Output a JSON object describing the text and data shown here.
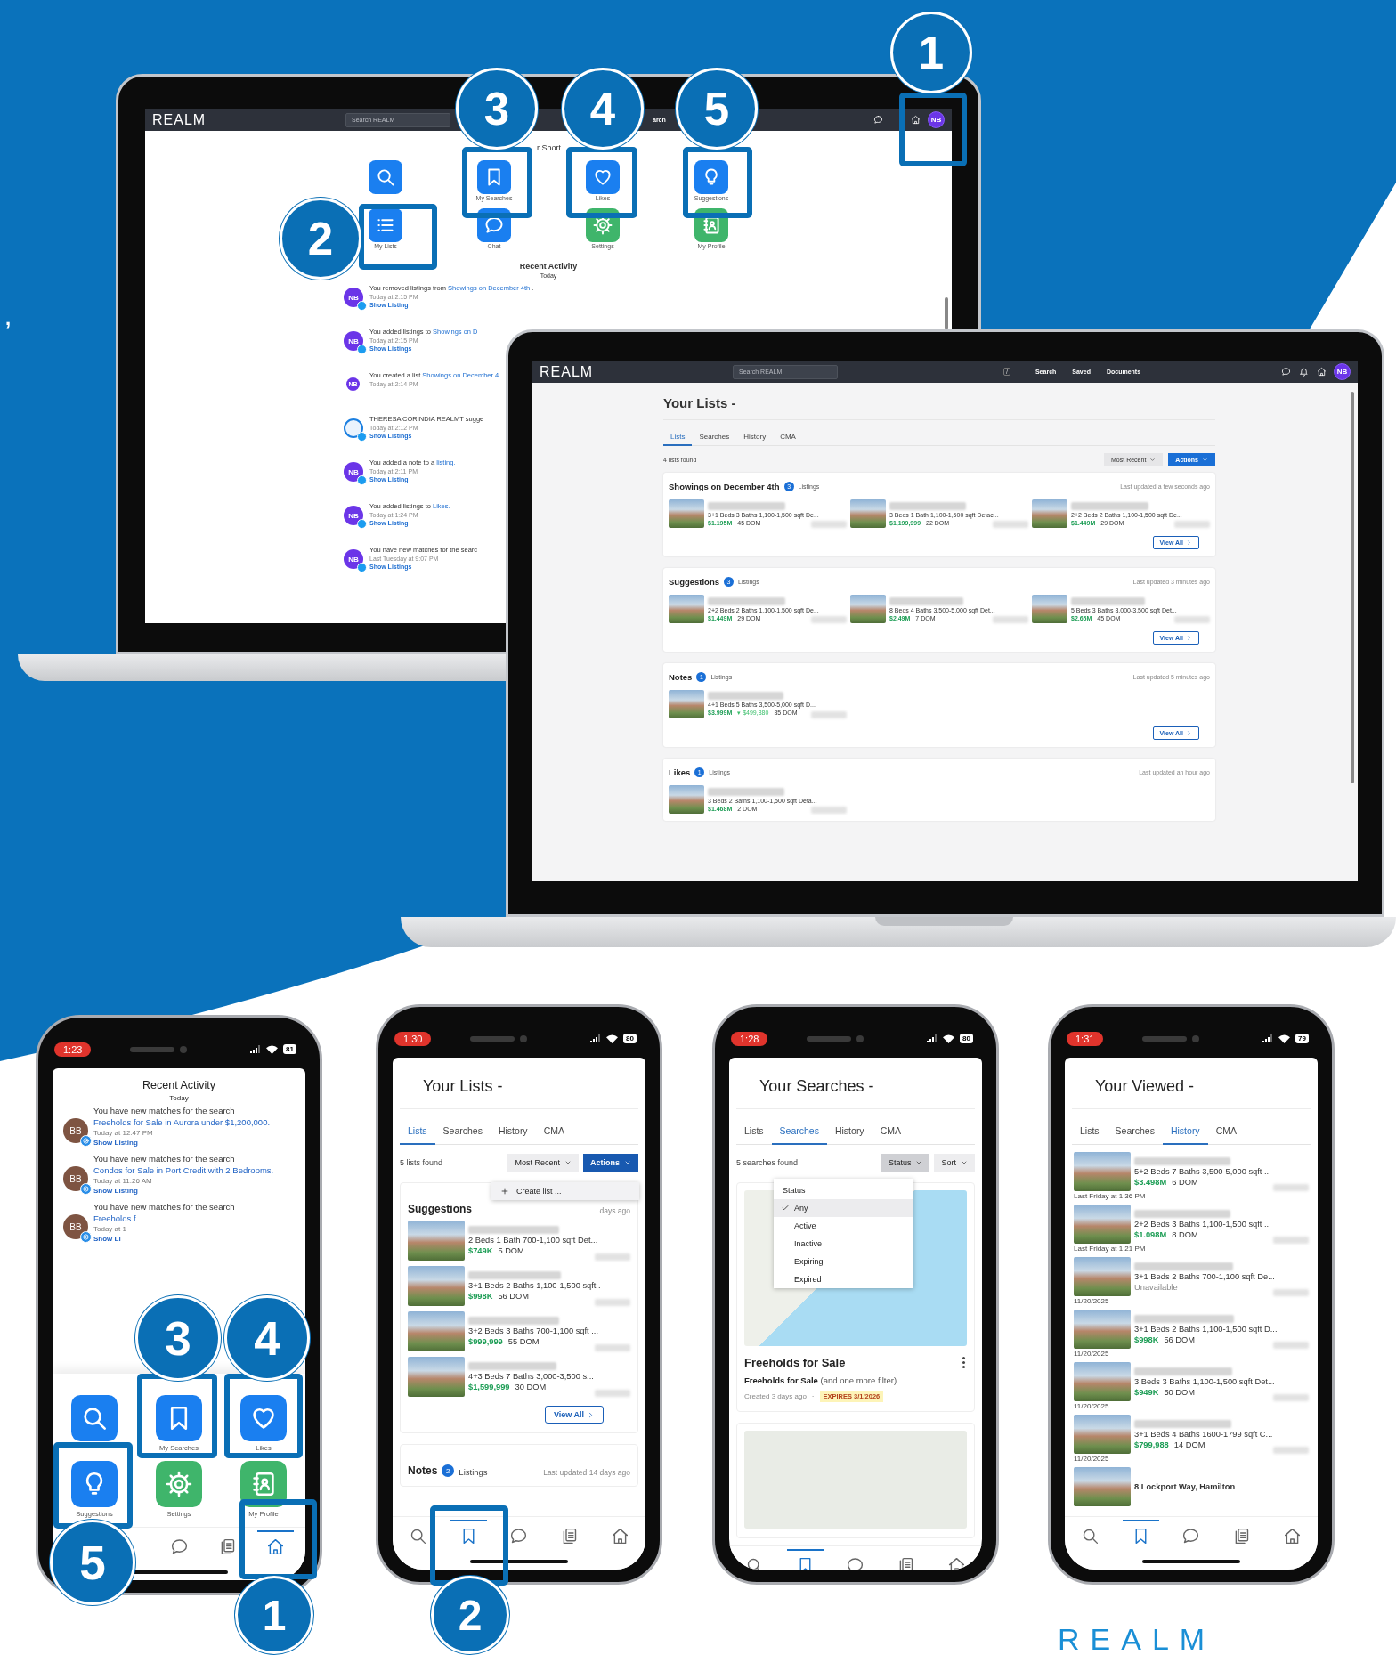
{
  "backdrop": {
    "edge_text": ",",
    "logo": "REALM"
  },
  "laptops": [
    {
      "kind": "home",
      "header": {
        "logo": "REALM",
        "search_placeholder": "Search REALM",
        "nav": [
          "arch"
        ],
        "icons": [
          {
            "kind": "chat"
          },
          {
            "kind": "home"
          }
        ],
        "avatar": "NB"
      },
      "shortcuts_heading": "r Short",
      "shortcuts": [
        {
          "kind": "search",
          "color": "#1a7ff0"
        },
        {
          "kind": "bookmark",
          "label": "My Searches",
          "color": "#1a7ff0"
        },
        {
          "kind": "heart",
          "label": "Likes",
          "color": "#1a7ff0"
        },
        {
          "kind": "bulb",
          "label": "Suggestions",
          "color": "#1a7ff0"
        },
        {
          "kind": "list",
          "label": "My Lists",
          "color": "#1a7ff0"
        },
        {
          "kind": "chat",
          "label": "Chat",
          "color": "#1a7ff0"
        },
        {
          "kind": "gear",
          "label": "Settings",
          "color": "#3fb56b"
        },
        {
          "kind": "profile",
          "label": "My Profile",
          "color": "#3fb56b"
        }
      ],
      "activity": {
        "title": "Recent Activity",
        "day": "Today",
        "items": [
          {
            "avatar": "NB",
            "kind": "user",
            "text": "You removed listings from ",
            "link": "Showings on December 4th",
            "after": " .",
            "time": "Today at 2:15 PM",
            "action": "Show Listing"
          },
          {
            "avatar": "NB",
            "kind": "user",
            "text": "You added listings to ",
            "link": "Showings on D",
            "time": "Today at 2:15 PM",
            "action": "Show Listings"
          },
          {
            "avatar": "NB",
            "kind": "small",
            "text": "You created a list ",
            "link": "Showings on December 4",
            "time": "Today at 2:14 PM"
          },
          {
            "kind": "agent",
            "text": "THERESA CORINDIA REALMT sugge",
            "time": "Today at 2:12 PM",
            "action": "Show Listings"
          },
          {
            "avatar": "NB",
            "kind": "user",
            "text": "You added a note to a ",
            "link": "listing.",
            "time": "Today at 2:11 PM",
            "action": "Show Listing"
          },
          {
            "avatar": "NB",
            "kind": "user",
            "text": "You added listings to ",
            "link": "Likes.",
            "time": "Today at 1:24 PM",
            "action": "Show Listing"
          },
          {
            "avatar": "NB",
            "kind": "user",
            "text": "You have new matches for the searc",
            "time": "Last Tuesday at 9:07 PM",
            "action": "Show Listings"
          }
        ]
      }
    },
    {
      "kind": "lists",
      "header": {
        "logo": "REALM",
        "search_placeholder": "Search REALM",
        "key_hint": "/",
        "nav": [
          "Search",
          "Saved",
          "Documents"
        ],
        "icons": [
          {
            "kind": "chat"
          },
          {
            "kind": "bell"
          },
          {
            "kind": "home"
          }
        ],
        "avatar": "NB"
      },
      "title": "Your Lists -",
      "tabs": [
        {
          "label": "Lists",
          "selected": true
        },
        {
          "label": "Searches",
          "selected": false
        },
        {
          "label": "History",
          "selected": false
        },
        {
          "label": "CMA",
          "selected": false
        }
      ],
      "count": "4 lists found",
      "sort": "Most Recent",
      "actions": "Actions",
      "cards": [
        {
          "title": "Showings on December 4th",
          "count": "3",
          "count_label": "Listings",
          "updated": "Last updated a few seconds ago",
          "view_all": "View All",
          "listings": [
            {
              "details": "3+1 Beds 3 Baths 1,100-1,500 sqft De...",
              "price": "$1.195M",
              "dom": "45 DOM"
            },
            {
              "details": "3 Beds 1 Bath 1,100-1,500 sqft Detac...",
              "price": "$1,199,999",
              "dom": "22 DOM"
            },
            {
              "details": "2+2 Beds 2 Baths 1,100-1,500 sqft De...",
              "price": "$1.449M",
              "dom": "29 DOM"
            }
          ]
        },
        {
          "title": "Suggestions",
          "count": "3",
          "count_label": "Listings",
          "updated": "Last updated 3 minutes ago",
          "view_all": "View All",
          "listings": [
            {
              "details": "2+2 Beds 2 Baths 1,100-1,500 sqft De...",
              "price": "$1.449M",
              "dom": "29 DOM"
            },
            {
              "details": "8 Beds 4 Baths 3,500-5,000 sqft Det...",
              "price": "$2.49M",
              "dom": "7 DOM"
            },
            {
              "details": "5 Beds 3 Baths 3,000-3,500 sqft Det...",
              "price": "$2.65M",
              "dom": "45 DOM"
            }
          ]
        },
        {
          "title": "Notes",
          "count": "1",
          "count_label": "Listings",
          "updated": "Last updated 5 minutes ago",
          "view_all": "View All",
          "listings": [
            {
              "details": "4+1 Beds 5 Baths 3,500-5,000 sqft D...",
              "price": "$3.999M",
              "drop": "▾ $499,880",
              "dom": "35 DOM"
            }
          ]
        },
        {
          "title": "Likes",
          "count": "1",
          "count_label": "Listings",
          "updated": "Last updated an hour ago",
          "listings": [
            {
              "details": "3 Beds 2 Baths 1,100-1,500 sqft Deta...",
              "price": "$1.468M",
              "dom": "2 DOM"
            }
          ]
        }
      ]
    }
  ],
  "phones": [
    {
      "kind": "activity",
      "time": "1:23",
      "battery": "81",
      "title": "Recent Activity",
      "day": "Today",
      "items": [
        {
          "avatar": "BB",
          "intro": "You have new matches for the search",
          "link": "Freeholds for Sale in Aurora under $1,200,000.",
          "time": "Today at 12:47 PM",
          "action": "Show Listing"
        },
        {
          "avatar": "BB",
          "intro": "You have new matches for the search",
          "link": "Condos for Sale in Port Credit with 2 Bedrooms.",
          "time": "Today at 11:26 AM",
          "action": "Show Listing"
        },
        {
          "avatar": "BB",
          "intro": "You have new matches for the search",
          "link": "Freeholds f",
          "time": "Today at 1",
          "action": "Show Li"
        }
      ],
      "shortcuts": [
        {
          "kind": "search",
          "color": "#1a7ff0"
        },
        {
          "kind": "bookmark",
          "label": "My Searches",
          "color": "#1a7ff0"
        },
        {
          "kind": "heart",
          "label": "Likes",
          "color": "#1a7ff0"
        },
        {
          "kind": "bulb",
          "label": "Suggestions",
          "color": "#1a7ff0"
        },
        {
          "kind": "gear",
          "label": "Settings",
          "color": "#3fb56b"
        },
        {
          "kind": "profile",
          "label": "My Profile",
          "color": "#3fb56b"
        }
      ],
      "nav": [
        {
          "kind": "chat",
          "selected": false
        },
        {
          "kind": "documents",
          "selected": false
        },
        {
          "kind": "home",
          "selected": true
        }
      ]
    },
    {
      "kind": "lists",
      "time": "1:30",
      "battery": "80",
      "title": "Your Lists -",
      "tabs": [
        {
          "label": "Lists",
          "selected": true
        },
        {
          "label": "Searches",
          "selected": false
        },
        {
          "label": "History",
          "selected": false
        },
        {
          "label": "CMA",
          "selected": false
        }
      ],
      "count": "5 lists found",
      "sort": "Most Recent",
      "actions": "Actions",
      "menu_item": "Create list ...",
      "cards": [
        {
          "title": "Suggestions",
          "updated": "days ago",
          "view_all": "View All",
          "listings": [
            {
              "details": "2 Beds 1 Bath 700-1,100 sqft Det...",
              "price": "$749K",
              "dom": "5 DOM"
            },
            {
              "details": "3+1 Beds 2 Baths 1,100-1,500 sqft .",
              "price": "$998K",
              "dom": "56 DOM"
            },
            {
              "details": "3+2 Beds 3 Baths 700-1,100 sqft ...",
              "price": "$999,999",
              "dom": "55 DOM"
            },
            {
              "details": "4+3 Beds 7 Baths 3,000-3,500 s...",
              "price": "$1,599,999",
              "dom": "30 DOM"
            }
          ]
        },
        {
          "title": "Notes",
          "count": "2",
          "count_label": "Listings",
          "updated": "Last updated 14 days ago"
        }
      ],
      "nav": [
        {
          "kind": "search",
          "selected": false
        },
        {
          "kind": "bookmark",
          "selected": true
        },
        {
          "kind": "chat",
          "selected": false
        },
        {
          "kind": "documents",
          "selected": false
        },
        {
          "kind": "home",
          "selected": false
        }
      ]
    },
    {
      "kind": "searches",
      "time": "1:28",
      "battery": "80",
      "title": "Your Searches -",
      "tabs": [
        {
          "label": "Lists",
          "selected": false
        },
        {
          "label": "Searches",
          "selected": true
        },
        {
          "label": "History",
          "selected": false
        },
        {
          "label": "CMA",
          "selected": false
        }
      ],
      "count": "5 searches found",
      "filters": [
        {
          "label": "Status",
          "selected": true
        },
        {
          "label": "Sort",
          "selected": false
        }
      ],
      "menu": {
        "title": "Status",
        "options": [
          {
            "label": "Any",
            "selected": true
          },
          {
            "label": "Active",
            "selected": false
          },
          {
            "label": "Inactive",
            "selected": false
          },
          {
            "label": "Expiring",
            "selected": false
          },
          {
            "label": "Expired",
            "selected": false
          }
        ]
      },
      "searches": [
        {
          "kind": "detailed",
          "title": "Freeholds for Sale",
          "summary": "**Freeholds for Sale** (and one more filter)",
          "created": "Created 3 days ago",
          "separator": "·",
          "expires": "EXPIRES 3/1/2026"
        },
        {
          "kind": "map_only"
        }
      ],
      "nav": [
        {
          "kind": "search",
          "selected": false
        },
        {
          "kind": "bookmark",
          "selected": true
        },
        {
          "kind": "chat",
          "selected": false
        },
        {
          "kind": "documents",
          "selected": false
        },
        {
          "kind": "home",
          "selected": false
        }
      ]
    },
    {
      "kind": "viewed",
      "time": "1:31",
      "battery": "79",
      "title": "Your Viewed -",
      "tabs": [
        {
          "label": "Lists",
          "selected": false
        },
        {
          "label": "Searches",
          "selected": false
        },
        {
          "label": "History",
          "selected": true
        },
        {
          "label": "CMA",
          "selected": false
        }
      ],
      "listings": [
        {
          "details": "5+2 Beds 7 Baths 3,500-5,000 sqft ...",
          "price": "$3.498M",
          "dom": "6 DOM",
          "viewed": "Last Friday at 1:36 PM"
        },
        {
          "details": "2+2 Beds 3 Baths 1,100-1,500 sqft ...",
          "price": "$1.098M",
          "dom": "8 DOM",
          "viewed": "Last Friday at 1:21 PM"
        },
        {
          "details": "3+1 Beds 2 Baths 700-1,100 sqft De...",
          "status": "Unavailable",
          "viewed": "11/20/2025"
        },
        {
          "details": "3+1 Beds 2 Baths 1,100-1,500 sqft D...",
          "price": "$998K",
          "dom": "56 DOM",
          "viewed": "11/20/2025"
        },
        {
          "details": "3 Beds 3 Baths 1,100-1,500 sqft Det...",
          "price": "$949K",
          "dom": "50 DOM",
          "viewed": "11/20/2025"
        },
        {
          "details": "3+1 Beds 4 Baths 1600-1799 sqft C...",
          "price": "$799,988",
          "dom": "14 DOM",
          "viewed": "11/20/2025"
        },
        {
          "address": "8 Lockport Way, Hamilton"
        }
      ],
      "nav": [
        {
          "kind": "search",
          "selected": false
        },
        {
          "kind": "bookmark",
          "selected": true
        },
        {
          "kind": "chat",
          "selected": false
        },
        {
          "kind": "documents",
          "selected": false
        },
        {
          "kind": "home",
          "selected": false
        }
      ]
    }
  ],
  "callouts": [
    {
      "number": "1"
    },
    {
      "number": "2"
    },
    {
      "number": "3"
    },
    {
      "number": "4"
    },
    {
      "number": "5"
    },
    {
      "number": "3"
    },
    {
      "number": "4"
    },
    {
      "number": "5"
    },
    {
      "number": "1"
    },
    {
      "number": "2"
    }
  ]
}
